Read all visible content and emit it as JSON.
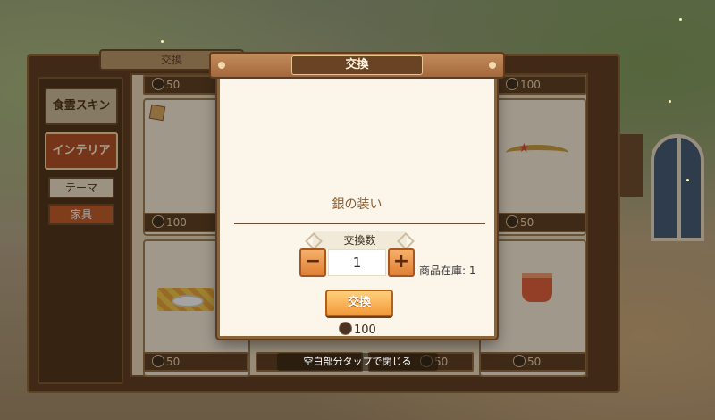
{
  "background_shop": {
    "title": "交換",
    "sidebar": [
      {
        "label": "食霊スキン",
        "active": false
      },
      {
        "label": "インテリア",
        "active": true
      }
    ],
    "subtabs": [
      {
        "label": "テーマ",
        "active": false
      },
      {
        "label": "家具",
        "active": true
      }
    ],
    "prices": {
      "top_left": "50",
      "top_right": "100",
      "row1_left": "100",
      "row1_right": "50",
      "row2_a": "50",
      "row2_c": "50",
      "row2_d": "50"
    }
  },
  "modal": {
    "title": "交換",
    "item_name": "銀の装い",
    "quantity_label": "交換数",
    "minus_label": "−",
    "plus_label": "+",
    "quantity_value": "1",
    "stock_text": "商品在庫: 1",
    "exchange_button": "交換",
    "cost_amount": "100"
  },
  "close_hint": "空白部分タップで閉じる",
  "colors": {
    "accent_orange": "#f29a3a",
    "frame_brown": "#5b3a1f",
    "modal_bg": "#fcf6ea"
  }
}
